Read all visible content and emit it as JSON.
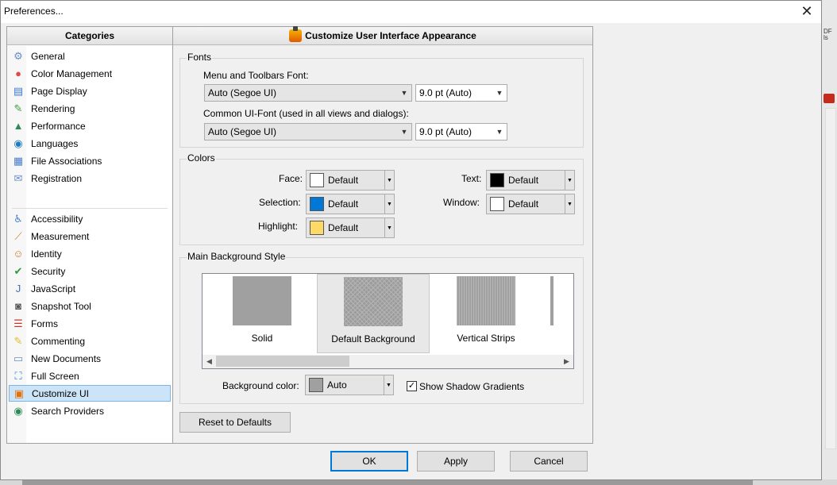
{
  "window": {
    "title": "Preferences...",
    "close_glyph": "✕"
  },
  "categories": {
    "header": "Categories",
    "items": [
      {
        "label": "General",
        "icon": "gear-icon",
        "color": "#6a8fc5",
        "glyph": "⚙"
      },
      {
        "label": "Color Management",
        "icon": "color-circles-icon",
        "color": "#e24a4a",
        "glyph": "●"
      },
      {
        "label": "Page Display",
        "icon": "page-display-icon",
        "color": "#3a7bd5",
        "glyph": "▤"
      },
      {
        "label": "Rendering",
        "icon": "rendering-icon",
        "color": "#3d9a3d",
        "glyph": "✎"
      },
      {
        "label": "Performance",
        "icon": "performance-chart-icon",
        "color": "#2e8b57",
        "glyph": "▲"
      },
      {
        "label": "Languages",
        "icon": "globe-icon",
        "color": "#1f7ac0",
        "glyph": "◉"
      },
      {
        "label": "File Associations",
        "icon": "file-associations-icon",
        "color": "#4a7ec9",
        "glyph": "▦"
      },
      {
        "label": "Registration",
        "icon": "registration-icon",
        "color": "#6b8cc7",
        "glyph": "✉"
      },
      {
        "label": "Accessibility",
        "icon": "accessibility-icon",
        "color": "#4a7ec9",
        "glyph": "♿"
      },
      {
        "label": "Measurement",
        "icon": "ruler-icon",
        "color": "#c77d2e",
        "glyph": "⟋"
      },
      {
        "label": "Identity",
        "icon": "identity-user-icon",
        "color": "#d07a2a",
        "glyph": "☺"
      },
      {
        "label": "Security",
        "icon": "shield-icon",
        "color": "#2f9a3a",
        "glyph": "✔"
      },
      {
        "label": "JavaScript",
        "icon": "javascript-icon",
        "color": "#4a6fb0",
        "glyph": "J"
      },
      {
        "label": "Snapshot Tool",
        "icon": "camera-icon",
        "color": "#555555",
        "glyph": "◙"
      },
      {
        "label": "Forms",
        "icon": "forms-icon",
        "color": "#c0392b",
        "glyph": "☰"
      },
      {
        "label": "Commenting",
        "icon": "comment-icon",
        "color": "#e5b82a",
        "glyph": "✎"
      },
      {
        "label": "New Documents",
        "icon": "new-document-icon",
        "color": "#6a8fc5",
        "glyph": "▭"
      },
      {
        "label": "Full Screen",
        "icon": "full-screen-icon",
        "color": "#2a7fd0",
        "glyph": "⛶"
      },
      {
        "label": "Customize UI",
        "icon": "customize-ui-icon",
        "color": "#e5700a",
        "glyph": "▣",
        "selected": true
      },
      {
        "label": "Search Providers",
        "icon": "search-providers-globe-icon",
        "color": "#2e8b57",
        "glyph": "◉"
      }
    ]
  },
  "main": {
    "header": "Customize User Interface Appearance",
    "fonts": {
      "legend": "Fonts",
      "menu_label": "Menu and Toolbars Font:",
      "menu_font": "Auto (Segoe UI)",
      "menu_size": "9.0 pt (Auto)",
      "common_label": "Common UI-Font (used in all views and dialogs):",
      "common_font": "Auto (Segoe UI)",
      "common_size": "9.0 pt (Auto)"
    },
    "colors": {
      "legend": "Colors",
      "face_label": "Face:",
      "face_value": "Default",
      "face_color": "#ffffff",
      "selection_label": "Selection:",
      "selection_value": "Default",
      "selection_color": "#0078d7",
      "highlight_label": "Highlight:",
      "highlight_value": "Default",
      "highlight_color": "#ffd966",
      "text_label": "Text:",
      "text_value": "Default",
      "text_color": "#000000",
      "window_label": "Window:",
      "window_value": "Default",
      "window_color": "#ffffff"
    },
    "background": {
      "legend": "Main Background Style",
      "styles": [
        {
          "label": "Solid"
        },
        {
          "label": "Default Background",
          "selected": true
        },
        {
          "label": "Vertical Strips"
        }
      ],
      "bgcolor_label": "Background color:",
      "bgcolor_value": "Auto",
      "shadow_label": "Show Shadow Gradients",
      "shadow_checked": true
    },
    "reset_label": "Reset to Defaults"
  },
  "buttons": {
    "ok": "OK",
    "apply": "Apply",
    "cancel": "Cancel"
  }
}
